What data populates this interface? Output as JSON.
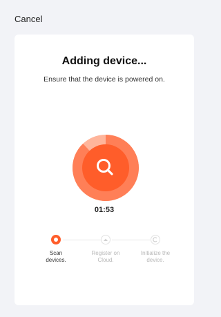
{
  "header": {
    "cancel_label": "Cancel"
  },
  "main": {
    "title": "Adding device...",
    "subtitle": "Ensure that the device is powered on.",
    "timer": "01:53",
    "progress_fraction": 0.88,
    "center_icon": "search-icon"
  },
  "steps": [
    {
      "label": "Scan\ndevices.",
      "state": "active",
      "icon": "scan-icon"
    },
    {
      "label": "Register on\nCloud.",
      "state": "pending",
      "icon": "cloud-icon"
    },
    {
      "label": "Initialize the\ndevice.",
      "state": "pending",
      "icon": "initialize-icon"
    }
  ],
  "colors": {
    "accent": "#ff5d2a",
    "accent_light": "#ffb59b",
    "background": "#f2f3f7",
    "card": "#ffffff",
    "inactive": "#dedede"
  }
}
